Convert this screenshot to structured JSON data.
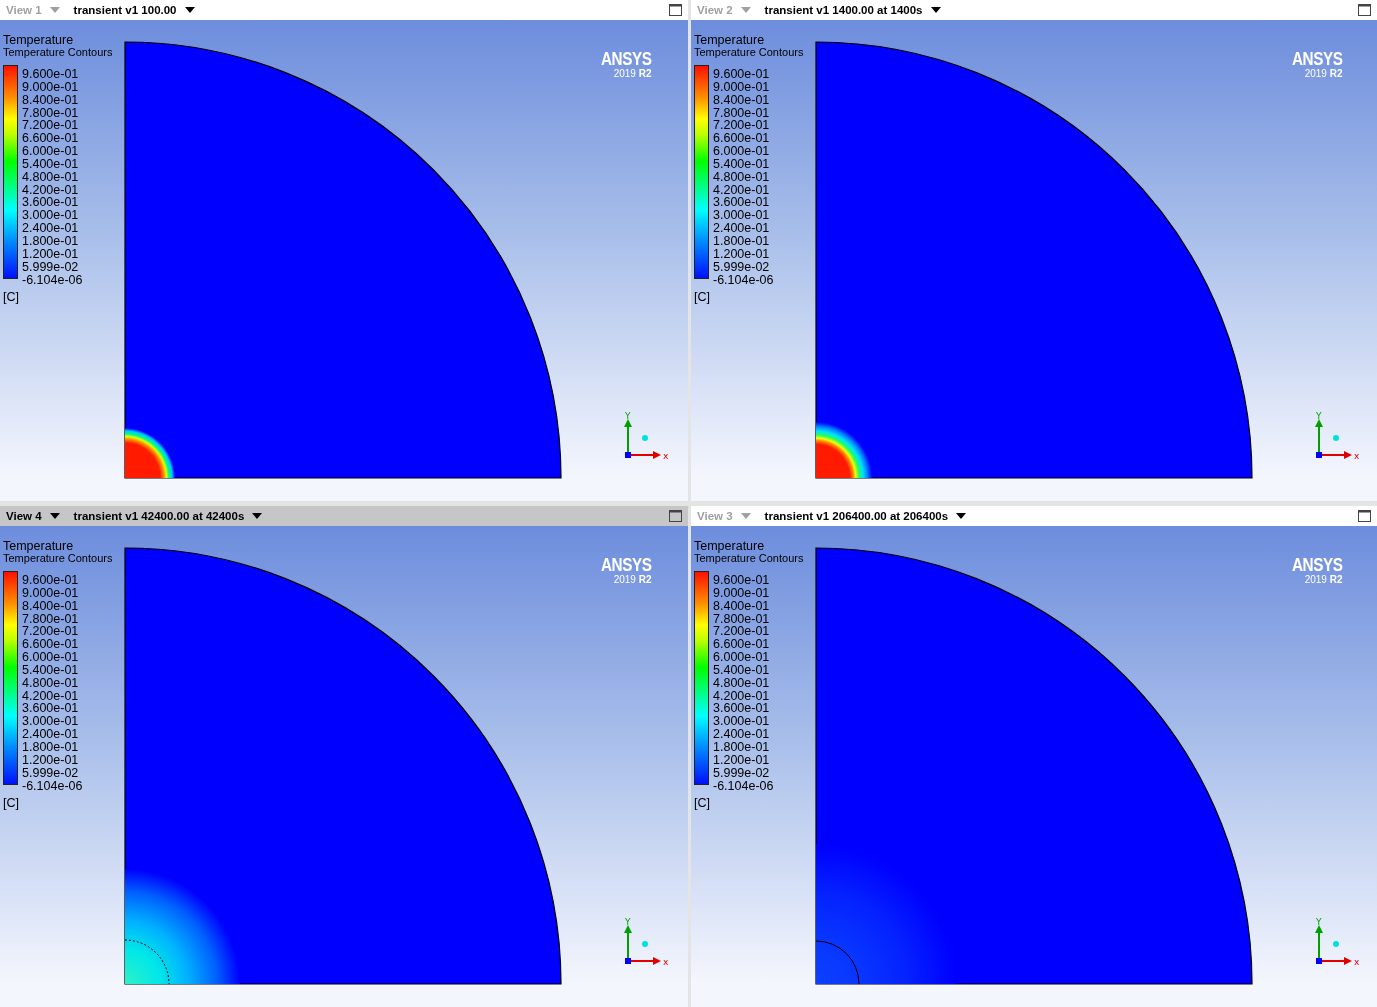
{
  "views": [
    {
      "label": "View 1",
      "title": "transient v1 100.00",
      "selected": false,
      "legend": {
        "title": "Temperature",
        "subtitle": "Temperature Contours",
        "ticks": [
          "9.600e-01",
          "9.000e-01",
          "8.400e-01",
          "7.800e-01",
          "7.200e-01",
          "6.600e-01",
          "6.000e-01",
          "5.400e-01",
          "4.800e-01",
          "4.200e-01",
          "3.600e-01",
          "3.000e-01",
          "2.400e-01",
          "1.800e-01",
          "1.200e-01",
          "5.999e-02",
          "-6.104e-06"
        ],
        "unit": "[C]"
      },
      "logo": {
        "name": "ANSYS",
        "version": "2019 **R2**"
      },
      "axes": {
        "y": "Y",
        "x": "x"
      }
    },
    {
      "label": "View 2",
      "title": "transient v1 1400.00 at 1400s",
      "selected": false,
      "legend": {
        "title": "Temperature",
        "subtitle": "Temperature Contours",
        "ticks": [
          "9.600e-01",
          "9.000e-01",
          "8.400e-01",
          "7.800e-01",
          "7.200e-01",
          "6.600e-01",
          "6.000e-01",
          "5.400e-01",
          "4.800e-01",
          "4.200e-01",
          "3.600e-01",
          "3.000e-01",
          "2.400e-01",
          "1.800e-01",
          "1.200e-01",
          "5.999e-02",
          "-6.104e-06"
        ],
        "unit": "[C]"
      },
      "logo": {
        "name": "ANSYS",
        "version": "2019 **R2**"
      },
      "axes": {
        "y": "Y",
        "x": "x"
      }
    },
    {
      "label": "View 4",
      "title": "transient v1 42400.00 at 42400s",
      "selected": true,
      "legend": {
        "title": "Temperature",
        "subtitle": "Temperature Contours",
        "ticks": [
          "9.600e-01",
          "9.000e-01",
          "8.400e-01",
          "7.800e-01",
          "7.200e-01",
          "6.600e-01",
          "6.000e-01",
          "5.400e-01",
          "4.800e-01",
          "4.200e-01",
          "3.600e-01",
          "3.000e-01",
          "2.400e-01",
          "1.800e-01",
          "1.200e-01",
          "5.999e-02",
          "-6.104e-06"
        ],
        "unit": "[C]"
      },
      "logo": {
        "name": "ANSYS",
        "version": "2019 **R2**"
      },
      "axes": {
        "y": "Y",
        "x": "x"
      }
    },
    {
      "label": "View 3",
      "title": "transient v1 206400.00 at 206400s",
      "selected": false,
      "legend": {
        "title": "Temperature",
        "subtitle": "Temperature Contours",
        "ticks": [
          "9.600e-01",
          "9.000e-01",
          "8.400e-01",
          "7.800e-01",
          "7.200e-01",
          "6.600e-01",
          "6.000e-01",
          "5.400e-01",
          "4.800e-01",
          "4.200e-01",
          "3.600e-01",
          "3.000e-01",
          "2.400e-01",
          "1.800e-01",
          "1.200e-01",
          "5.999e-02",
          "-6.104e-06"
        ],
        "unit": "[C]"
      },
      "logo": {
        "name": "ANSYS",
        "version": "2019 **R2**"
      },
      "axes": {
        "y": "Y",
        "x": "x"
      }
    }
  ]
}
